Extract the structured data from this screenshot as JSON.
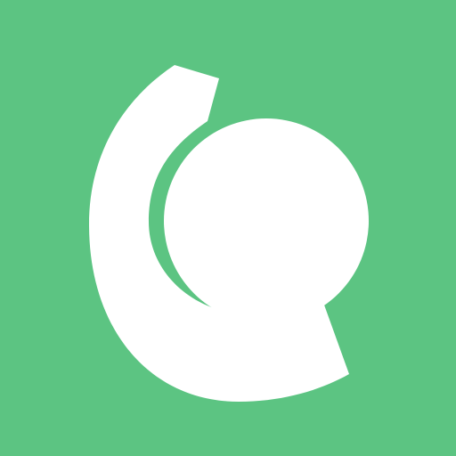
{
  "icon": {
    "name": "app-logo-icon",
    "background_color": "#5cc482",
    "foreground_color": "#ffffff"
  }
}
